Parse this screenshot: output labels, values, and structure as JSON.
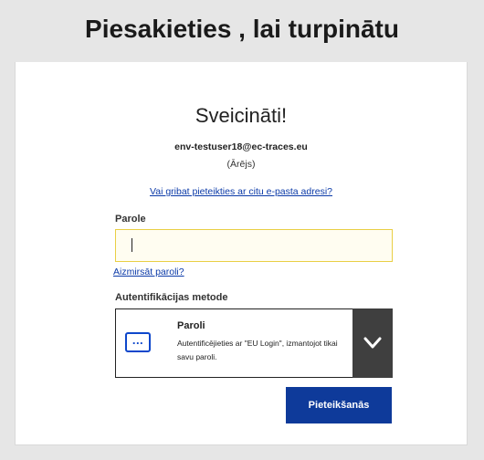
{
  "header": {
    "title": "Piesakieties , lai turpinātu"
  },
  "login": {
    "welcome": "Sveicināti!",
    "email": "env-testuser18@ec-traces.eu",
    "user_type": "(Ārējs)",
    "alt_email_link": "Vai gribat pieteikties ar citu e-pasta adresi?",
    "password_label": "Parole",
    "password_value": "",
    "forgot_password_link": "Aizmirsāt paroli?",
    "auth_method_label": "Autentifikācijas metode",
    "auth_method": {
      "icon": "password-icon",
      "title": "Paroli",
      "description": "Autentificējieties ar \"EU Login\", izmantojot tikai savu paroli.",
      "toggle_icon": "chevron-down-icon"
    },
    "submit_label": "Pieteikšanās"
  },
  "colors": {
    "background": "#e6e6e6",
    "link": "#0b3aa8",
    "input_border": "#e9cf45",
    "accent": "#0e47cb",
    "button": "#0e3a9a",
    "toggle": "#3f3f3f"
  }
}
